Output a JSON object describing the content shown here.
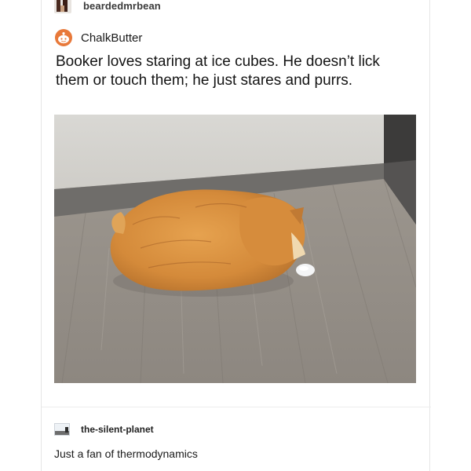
{
  "post": {
    "op": {
      "username": "beardedmrbean",
      "avatar_icon": "bearded-avatar-icon"
    },
    "reblog": {
      "username": "ChalkButter",
      "avatar_icon": "reddit-snoo-avatar-icon",
      "text": "Booker loves staring at ice cubes. He doesn’t lick them or touch them; he just stares and purrs.",
      "image": {
        "subject": "orange-cat-staring-at-ice-cube-photo"
      }
    },
    "reply": {
      "username": "the-silent-planet",
      "avatar_icon": "landscape-avatar-icon",
      "text": "Just a fan of thermodynamics"
    }
  },
  "colors": {
    "accent_orange": "#e8793a",
    "text": "#141414",
    "divider": "#ececec"
  }
}
